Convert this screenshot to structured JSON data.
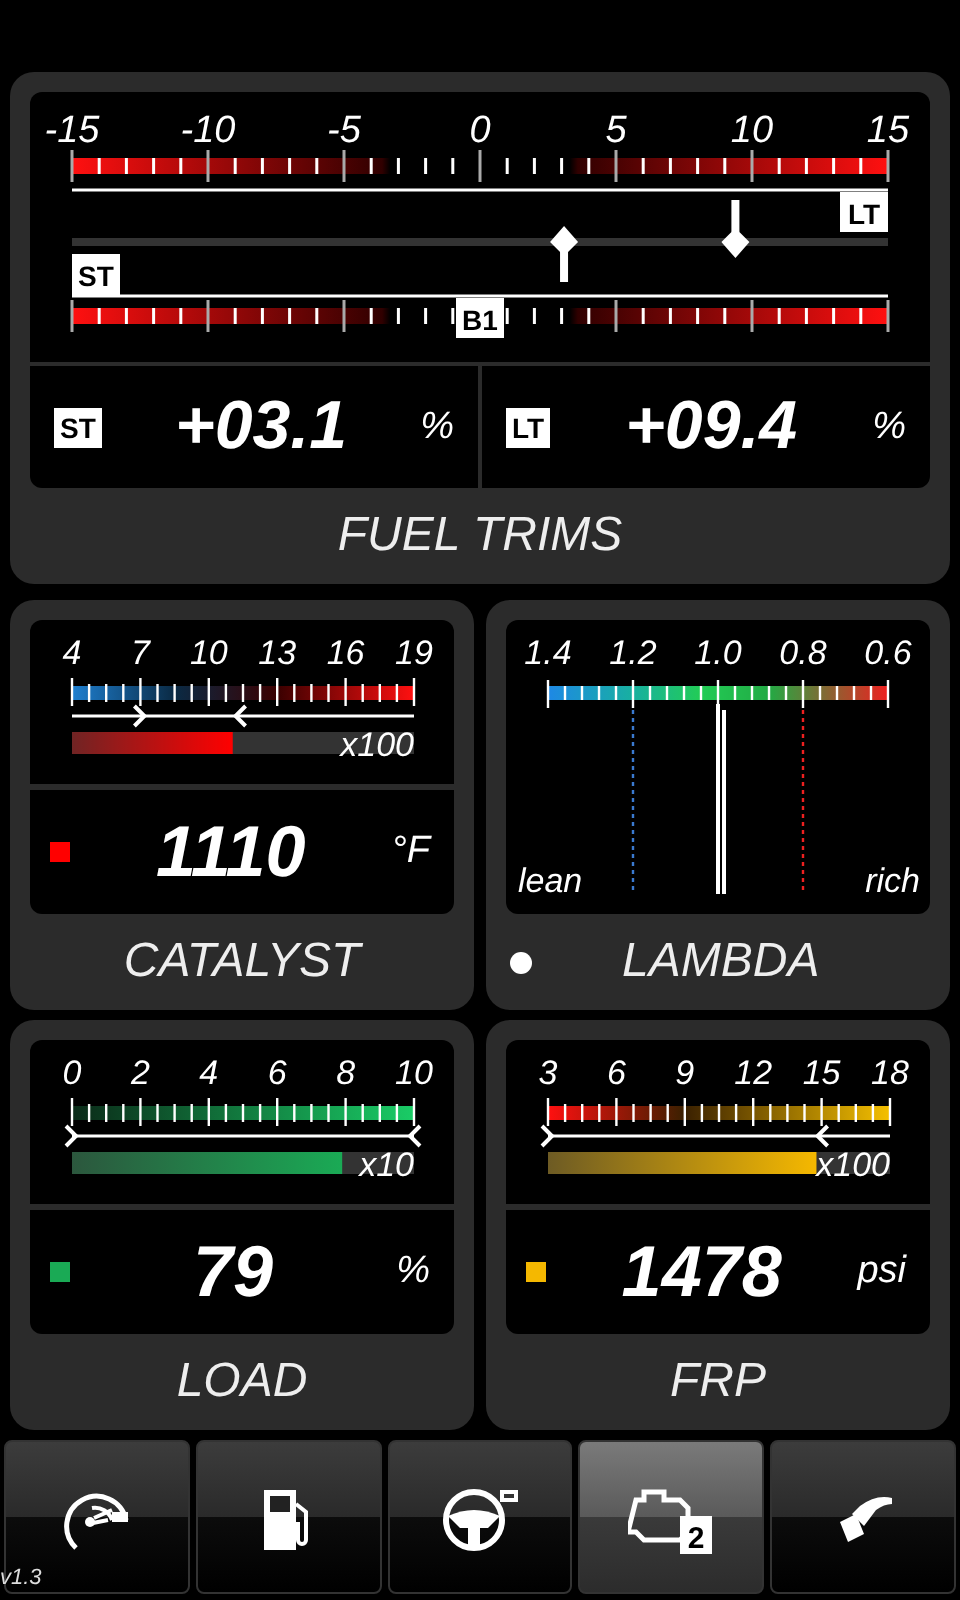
{
  "fuel_trims": {
    "title": "FUEL TRIMS",
    "scale": [
      "-15",
      "-10",
      "-5",
      "0",
      "5",
      "10",
      "15"
    ],
    "markers": [
      {
        "tag": "LT",
        "level": 0.813
      },
      {
        "tag": "ST",
        "level": 0.603
      }
    ],
    "bank": "B1",
    "readouts": [
      {
        "tag": "ST",
        "value": "+03.1",
        "unit": "%"
      },
      {
        "tag": "LT",
        "value": "+09.4",
        "unit": "%"
      }
    ]
  },
  "gauges": [
    {
      "kind": "bar",
      "title": "CATALYST",
      "scale": [
        "4",
        "7",
        "10",
        "13",
        "16",
        "19"
      ],
      "multiplier": "x100",
      "level": 0.47,
      "color": "#ff0000",
      "value": "1110",
      "unit": "°F"
    },
    {
      "kind": "lambda",
      "title": "LAMBDA",
      "scale": [
        "1.4",
        "1.2",
        "1.0",
        "0.8",
        "0.6"
      ],
      "left_note": "lean",
      "right_note": "rich",
      "color": "#ffffff"
    },
    {
      "kind": "bar",
      "title": "LOAD",
      "scale": [
        "0",
        "2",
        "4",
        "6",
        "8",
        "10"
      ],
      "multiplier": "x10",
      "level": 0.79,
      "color": "#1aaa55",
      "value": "79",
      "unit": "%"
    },
    {
      "kind": "bar",
      "title": "FRP",
      "scale": [
        "3",
        "6",
        "9",
        "12",
        "15",
        "18"
      ],
      "multiplier": "x100",
      "level": 0.785,
      "color": "#f5b800",
      "value": "1478",
      "unit": "psi"
    }
  ],
  "nav": [
    {
      "kind": "gauge",
      "selected": false
    },
    {
      "kind": "fuel",
      "selected": false
    },
    {
      "kind": "steering",
      "selected": false
    },
    {
      "kind": "engine",
      "badge": "2",
      "selected": true
    },
    {
      "kind": "nozzle",
      "selected": false
    }
  ],
  "version": "v1.3"
}
